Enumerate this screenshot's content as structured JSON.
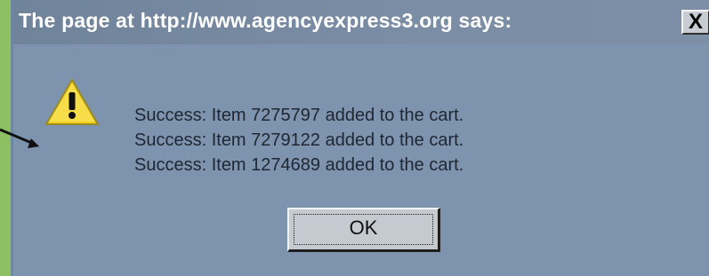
{
  "dialog": {
    "title": "The page at http://www.agencyexpress3.org says:",
    "close_icon": "close-icon",
    "icon": "warning-icon",
    "messages": [
      "Success: Item 7275797 added to the cart.",
      "Success: Item 7279122 added to the cart.",
      "Success: Item 1274689 added to the cart."
    ],
    "ok_label": "OK",
    "close_label": "X"
  },
  "colors": {
    "dialog_background": "#7e93ad",
    "page_background": "#8cc063",
    "button_face": "#c5c9d0",
    "warning_yellow": "#f3d21d"
  }
}
